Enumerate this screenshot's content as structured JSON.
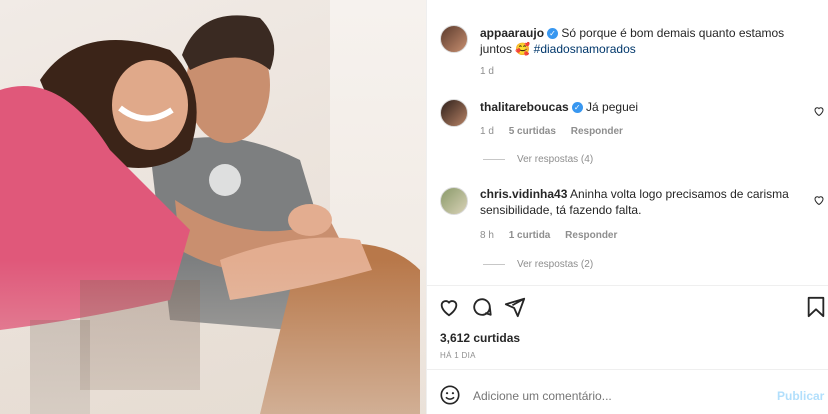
{
  "post": {
    "author": "appaaraujo",
    "caption_text": "Só porque é bom demais quanto estamos juntos",
    "caption_emoji": "🥰",
    "caption_hashtag": "#diadosnamorados",
    "time": "1 d"
  },
  "comments": [
    {
      "username": "thalitareboucas",
      "verified": true,
      "text": "Já peguei",
      "time": "1 d",
      "likes": "5 curtidas",
      "reply_label": "Responder",
      "view_replies": "Ver respostas (4)"
    },
    {
      "username": "chris.vidinha43",
      "verified": false,
      "text": "Aninha volta logo precisamos de carisma sensibilidade, tá fazendo falta.",
      "time": "8 h",
      "likes": "1 curtida",
      "reply_label": "Responder",
      "view_replies": "Ver respostas (2)"
    }
  ],
  "stats": {
    "likes": "3,612 curtidas",
    "date": "HÁ 1 DIA"
  },
  "comment_box": {
    "placeholder": "Adicione um comentário...",
    "publish_label": "Publicar"
  },
  "colors": {
    "verified": "#3897f0",
    "publish": "#b2dffc",
    "hashtag": "#00376b"
  }
}
